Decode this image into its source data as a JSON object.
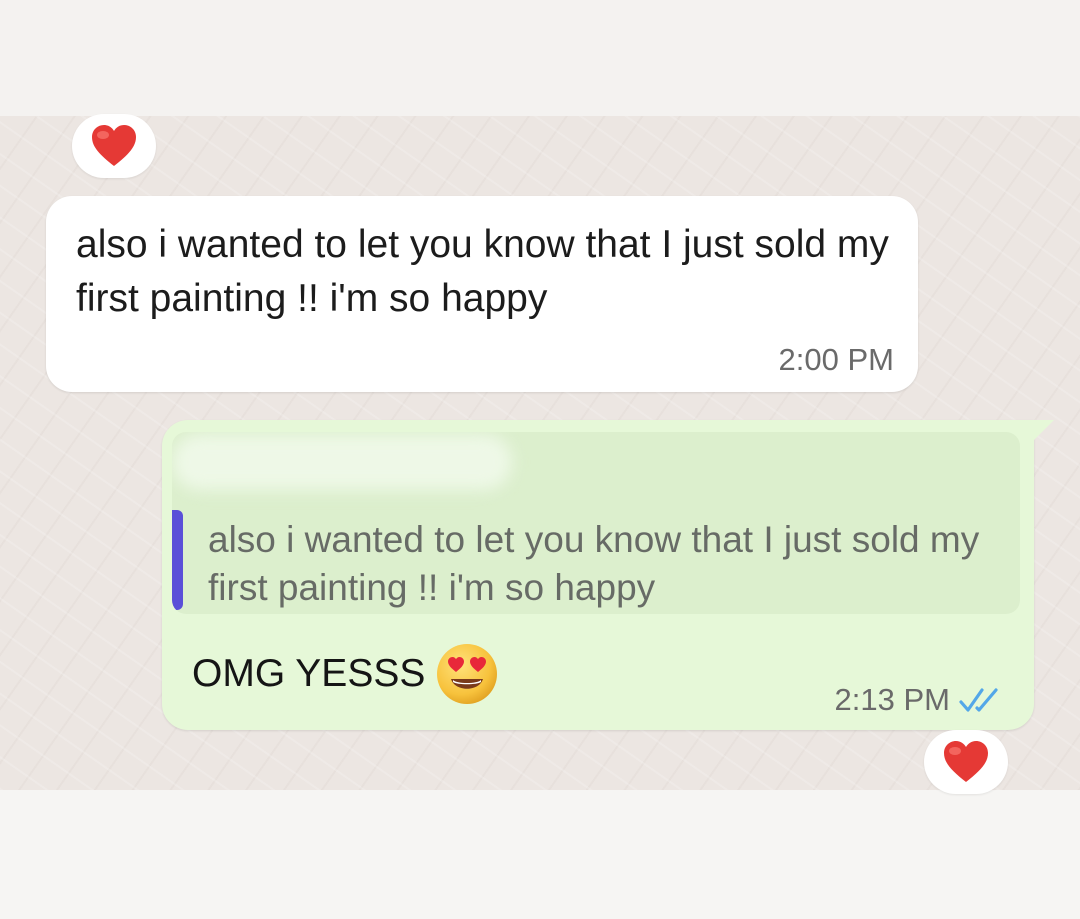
{
  "messages": [
    {
      "direction": "incoming",
      "text": "also i wanted to let you know that I just sold my first painting !! i'm so happy",
      "time": "2:00 PM",
      "reaction": "red-heart"
    },
    {
      "direction": "outgoing",
      "quoted_text": "also i wanted to let you know that I just sold my first painting !! i'm so happy",
      "text": "OMG YESSS",
      "emoji": "smiling-face-with-heart-eyes",
      "time": "2:13 PM",
      "status": "read",
      "status_icon": "double-check-icon",
      "reaction": "red-heart"
    }
  ],
  "colors": {
    "chat_background": "#ece6e2",
    "incoming_bubble": "#ffffff",
    "outgoing_bubble": "#e6f8d8",
    "quote_background": "#dcefcd",
    "quote_bar": "#5a4fd8",
    "read_ticks": "#53a7e8",
    "heart": "#e53935"
  }
}
